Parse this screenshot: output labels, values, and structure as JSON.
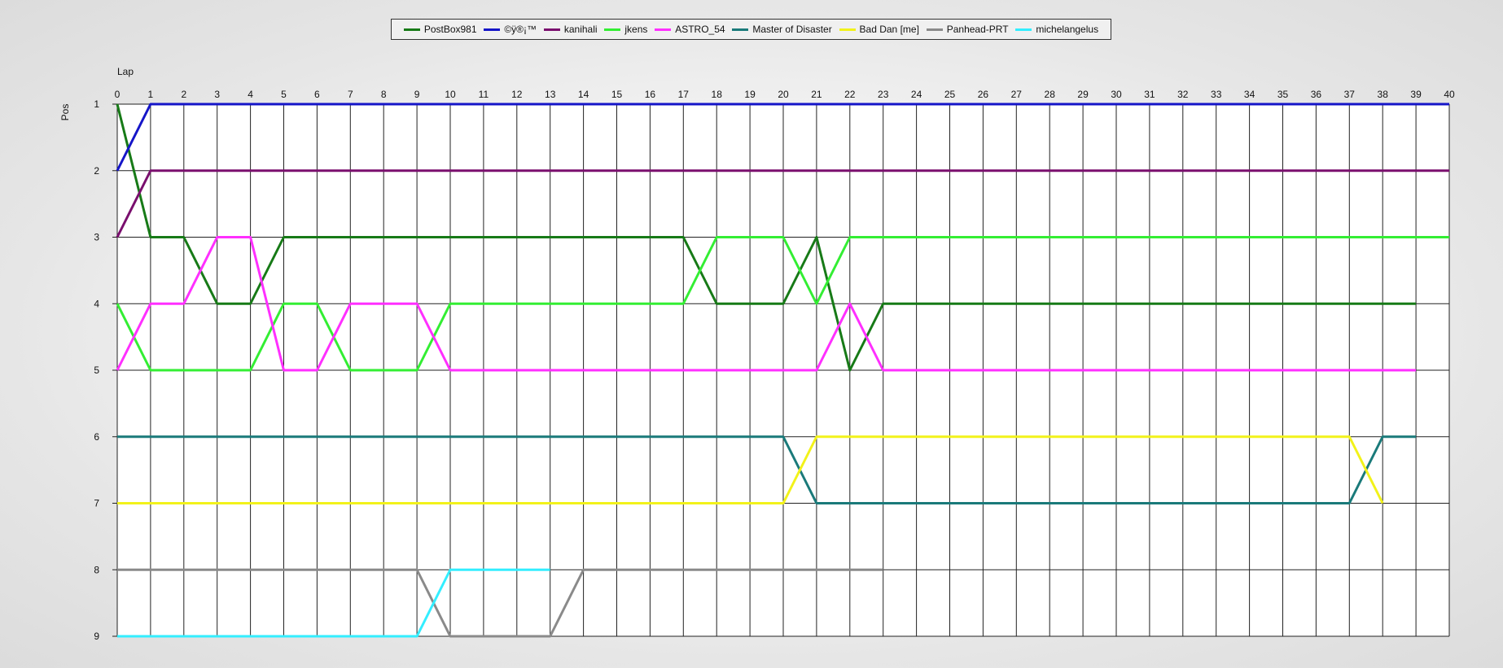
{
  "chart_data": {
    "type": "line",
    "xlabel": "Lap",
    "ylabel": "Pos",
    "xlim": [
      0,
      40
    ],
    "ylim": [
      1,
      9
    ],
    "x_ticks": [
      0,
      1,
      2,
      3,
      4,
      5,
      6,
      7,
      8,
      9,
      10,
      11,
      12,
      13,
      14,
      15,
      16,
      17,
      18,
      19,
      20,
      21,
      22,
      23,
      24,
      25,
      26,
      27,
      28,
      29,
      30,
      31,
      32,
      33,
      34,
      35,
      36,
      37,
      38,
      39,
      40
    ],
    "y_ticks": [
      1,
      2,
      3,
      4,
      5,
      6,
      7,
      8,
      9
    ],
    "grid": true,
    "legend_position": "top-center",
    "series": [
      {
        "name": "PostBox981",
        "color": "#177a17",
        "x": [
          0,
          1,
          2,
          3,
          4,
          5,
          17,
          18,
          20,
          21,
          22,
          23,
          39
        ],
        "values": [
          1,
          3,
          3,
          4,
          4,
          3,
          3,
          4,
          4,
          3,
          5,
          4,
          4
        ]
      },
      {
        "name": "©ÿ®¡™",
        "color": "#1515c8",
        "x": [
          0,
          1,
          40
        ],
        "values": [
          2,
          1,
          1
        ]
      },
      {
        "name": "kanihali",
        "color": "#7a0f6e",
        "x": [
          0,
          1,
          40
        ],
        "values": [
          3,
          2,
          2
        ]
      },
      {
        "name": "jkens",
        "color": "#33ee33",
        "x": [
          0,
          1,
          4,
          5,
          6,
          7,
          9,
          10,
          17,
          18,
          20,
          21,
          22,
          40
        ],
        "values": [
          4,
          5,
          5,
          4,
          4,
          5,
          5,
          4,
          4,
          3,
          3,
          4,
          3,
          3
        ]
      },
      {
        "name": "ASTRO_54",
        "color": "#ff2fff",
        "x": [
          0,
          1,
          2,
          3,
          4,
          5,
          6,
          7,
          9,
          10,
          21,
          22,
          23,
          39
        ],
        "values": [
          5,
          4,
          4,
          3,
          3,
          5,
          5,
          4,
          4,
          5,
          5,
          4,
          5,
          5
        ]
      },
      {
        "name": "Master of Disaster",
        "color": "#1a7a7a",
        "x": [
          0,
          20,
          21,
          37,
          38,
          39
        ],
        "values": [
          6,
          6,
          7,
          7,
          6,
          6
        ]
      },
      {
        "name": "Bad Dan [me]",
        "color": "#f2f21a",
        "x": [
          0,
          20,
          21,
          37,
          38
        ],
        "values": [
          7,
          7,
          6,
          6,
          7
        ]
      },
      {
        "name": "Panhead-PRT",
        "color": "#8a8a8a",
        "x": [
          0,
          9,
          10,
          13,
          14,
          23
        ],
        "values": [
          8,
          8,
          9,
          9,
          8,
          8
        ]
      },
      {
        "name": "michelangelus",
        "color": "#33eeff",
        "x": [
          0,
          9,
          10,
          13
        ],
        "values": [
          9,
          9,
          8,
          8
        ]
      }
    ]
  }
}
